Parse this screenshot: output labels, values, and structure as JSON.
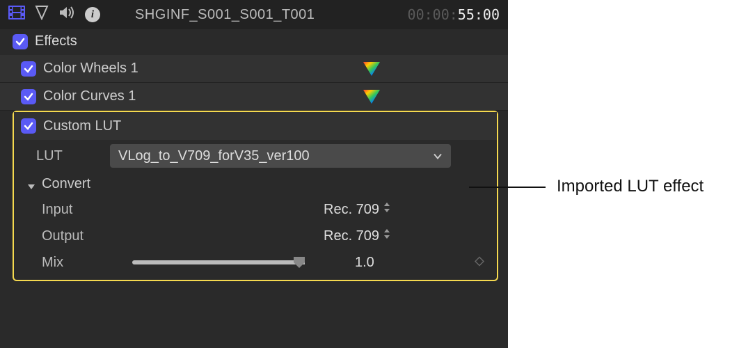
{
  "header": {
    "clip_name": "SHGINF_S001_S001_T001",
    "timecode_dim": "00:00:",
    "timecode_bright": "55:00"
  },
  "effects_section": {
    "label": "Effects",
    "rows": [
      {
        "name": "Color Wheels 1"
      },
      {
        "name": "Color Curves 1"
      }
    ]
  },
  "custom_lut": {
    "title": "Custom LUT",
    "lut_label": "LUT",
    "lut_value": "VLog_to_V709_forV35_ver100",
    "convert_label": "Convert",
    "input_label": "Input",
    "input_value": "Rec. 709",
    "output_label": "Output",
    "output_value": "Rec. 709",
    "mix_label": "Mix",
    "mix_value": "1.0"
  },
  "callout": {
    "text": "Imported LUT effect"
  }
}
